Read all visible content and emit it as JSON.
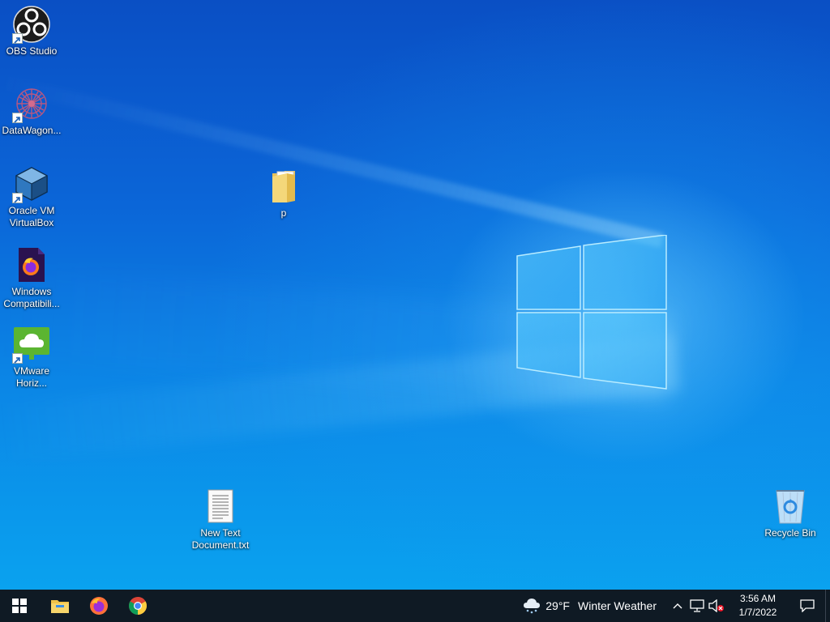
{
  "desktop_icons": {
    "obs": {
      "label": "OBS Studio",
      "icon": "obs-studio-icon",
      "shortcut": true
    },
    "datawagon": {
      "label": "DataWagon...",
      "icon": "datawagon-icon",
      "shortcut": true
    },
    "virtualbox": {
      "label": "Oracle VM VirtualBox",
      "icon": "virtualbox-icon",
      "shortcut": true
    },
    "windows_compat": {
      "label": "Windows Compatibili...",
      "icon": "firefox-dark-icon",
      "shortcut": false
    },
    "vmware": {
      "label": "VMware Horiz...",
      "icon": "vmware-horizon-icon",
      "shortcut": true
    },
    "folder_p": {
      "label": "p",
      "icon": "folder-icon",
      "shortcut": false
    },
    "new_text": {
      "label": "New Text Document.txt",
      "icon": "text-file-icon",
      "shortcut": false
    },
    "recycle_bin": {
      "label": "Recycle Bin",
      "icon": "recycle-bin-icon",
      "shortcut": false
    }
  },
  "taskbar": {
    "start": {
      "icon": "windows-start-icon"
    },
    "pinned": [
      {
        "name": "File Explorer",
        "icon": "file-explorer-icon"
      },
      {
        "name": "Firefox",
        "icon": "firefox-icon"
      },
      {
        "name": "Chrome",
        "icon": "chrome-icon"
      }
    ],
    "weather": {
      "temp": "29°F",
      "text": "Winter Weather",
      "icon": "weather-snow-cloud-icon"
    },
    "tray": {
      "chevron": "chevron-up-icon",
      "network": "network-icon",
      "volume": "volume-muted-icon"
    },
    "clock": {
      "time": "3:56 AM",
      "date": "1/7/2022"
    },
    "notifications": {
      "icon": "notification-icon"
    }
  },
  "colors": {
    "taskbar": "#0f1a24",
    "desktop_top": "#0a4fc4",
    "desktop_bottom": "#0aa2ef"
  }
}
